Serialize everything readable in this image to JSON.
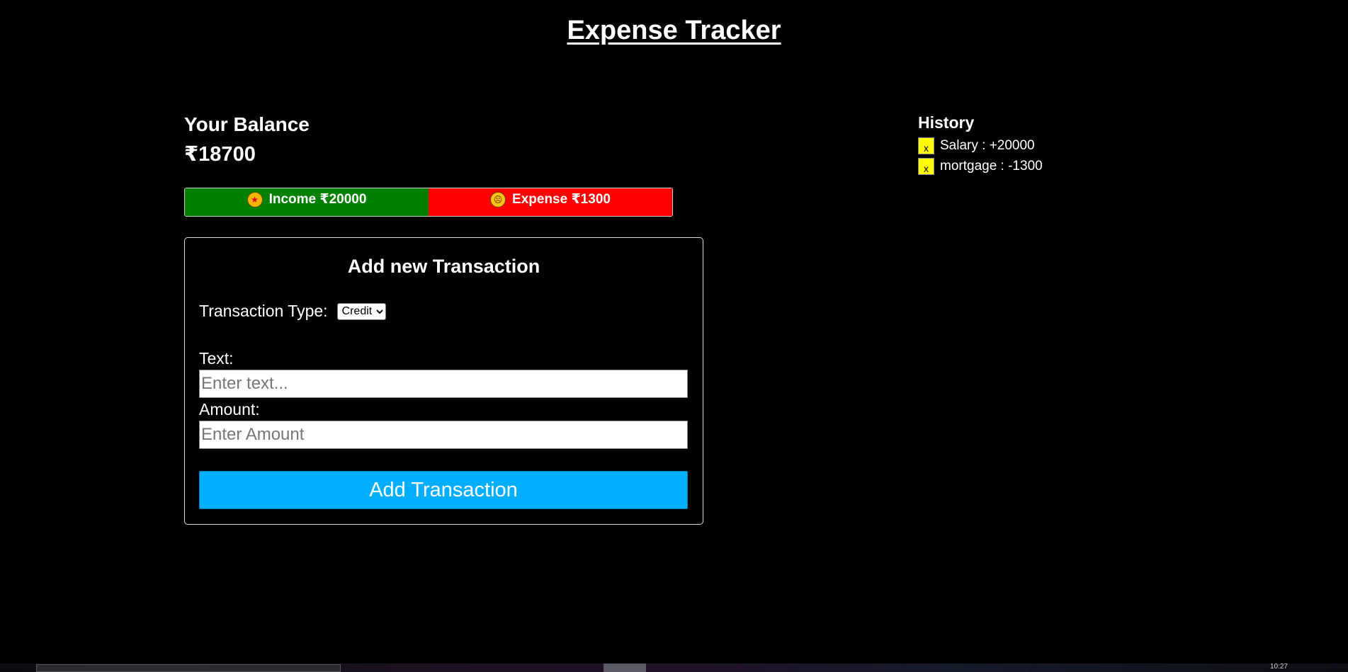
{
  "header": {
    "title": "Expense Tracker"
  },
  "balance": {
    "label": "Your Balance",
    "value": "₹18700"
  },
  "summary": {
    "income_label": "Income ₹20000",
    "expense_label": "Expense ₹1300",
    "income_color": "#008000",
    "expense_color": "#ff0000"
  },
  "form": {
    "title": "Add new Transaction",
    "type_label": "Transaction Type:",
    "type_selected": "Credit",
    "type_options": [
      "Credit"
    ],
    "text_label": "Text:",
    "text_placeholder": "Enter text...",
    "amount_label": "Amount:",
    "amount_placeholder": "Enter Amount",
    "submit_label": "Add Transaction",
    "accent_color": "#00aeff"
  },
  "history": {
    "title": "History",
    "items": [
      {
        "delete_label": "x",
        "text": "Salary : +20000"
      },
      {
        "delete_label": "x",
        "text": "mortgage : -1300"
      }
    ]
  },
  "taskbar": {
    "clock": "10:27"
  }
}
